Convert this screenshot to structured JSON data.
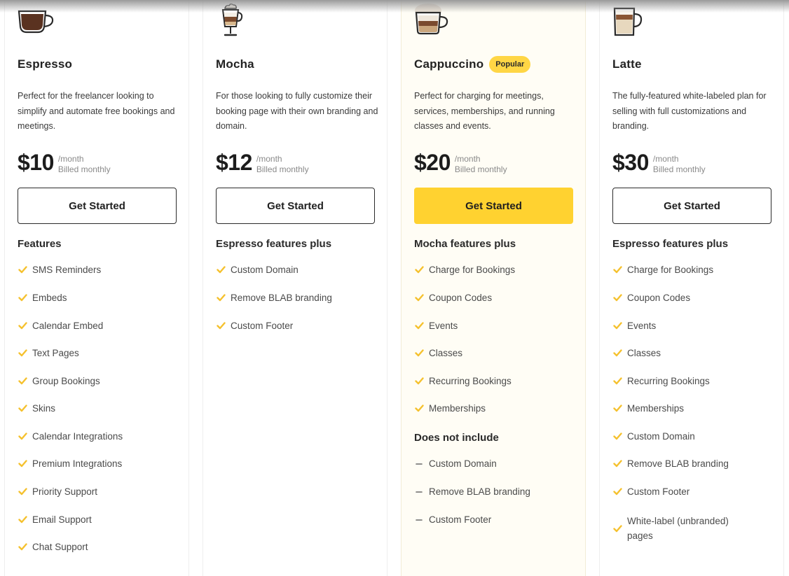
{
  "accent_color": "#ffd230",
  "check_color": "#f5c12e",
  "plans": [
    {
      "icon": "espresso-cup-icon",
      "name": "Espresso",
      "badge": "",
      "description": "Perfect for the freelancer looking to simplify and automate free bookings and meetings.",
      "price": "$10",
      "period": "/month",
      "billing": "Billed monthly",
      "cta": "Get Started",
      "highlight": false,
      "sections": [
        {
          "heading": "Features",
          "type": "included",
          "items": [
            "SMS Reminders",
            "Embeds",
            "Calendar Embed",
            "Text Pages",
            "Group Bookings",
            "Skins",
            "Calendar Integrations",
            "Premium Integrations",
            "Priority Support",
            "Email Support",
            "Chat Support"
          ]
        }
      ]
    },
    {
      "icon": "mocha-glass-icon",
      "name": "Mocha",
      "badge": "",
      "description": "For those looking to fully customize their booking page with their own branding and domain.",
      "price": "$12",
      "period": "/month",
      "billing": "Billed monthly",
      "cta": "Get Started",
      "highlight": false,
      "sections": [
        {
          "heading": "Espresso features plus",
          "type": "included",
          "items": [
            "Custom Domain",
            "Remove BLAB branding",
            "Custom Footer"
          ]
        }
      ]
    },
    {
      "icon": "cappuccino-cup-icon",
      "name": "Cappuccino",
      "badge": "Popular",
      "description": "Perfect for charging for meetings, services, memberships, and running classes and events.",
      "price": "$20",
      "period": "/month",
      "billing": "Billed monthly",
      "cta": "Get Started",
      "highlight": true,
      "sections": [
        {
          "heading": "Mocha features plus",
          "type": "included",
          "items": [
            "Charge for Bookings",
            "Coupon Codes",
            "Events",
            "Classes",
            "Recurring Bookings",
            "Memberships"
          ]
        },
        {
          "heading": "Does not include",
          "type": "excluded",
          "items": [
            "Custom Domain",
            "Remove BLAB branding",
            "Custom Footer"
          ]
        }
      ]
    },
    {
      "icon": "latte-glass-icon",
      "name": "Latte",
      "badge": "",
      "description": "The fully-featured white-labeled plan for selling with full customizations and branding.",
      "price": "$30",
      "period": "/month",
      "billing": "Billed monthly",
      "cta": "Get Started",
      "highlight": false,
      "sections": [
        {
          "heading": "Espresso features plus",
          "type": "included",
          "items": [
            "Charge for Bookings",
            "Coupon Codes",
            "Events",
            "Classes",
            "Recurring Bookings",
            "Memberships",
            "Custom Domain",
            "Remove BLAB branding",
            "Custom Footer",
            "White-label (unbranded) pages"
          ]
        }
      ]
    }
  ]
}
